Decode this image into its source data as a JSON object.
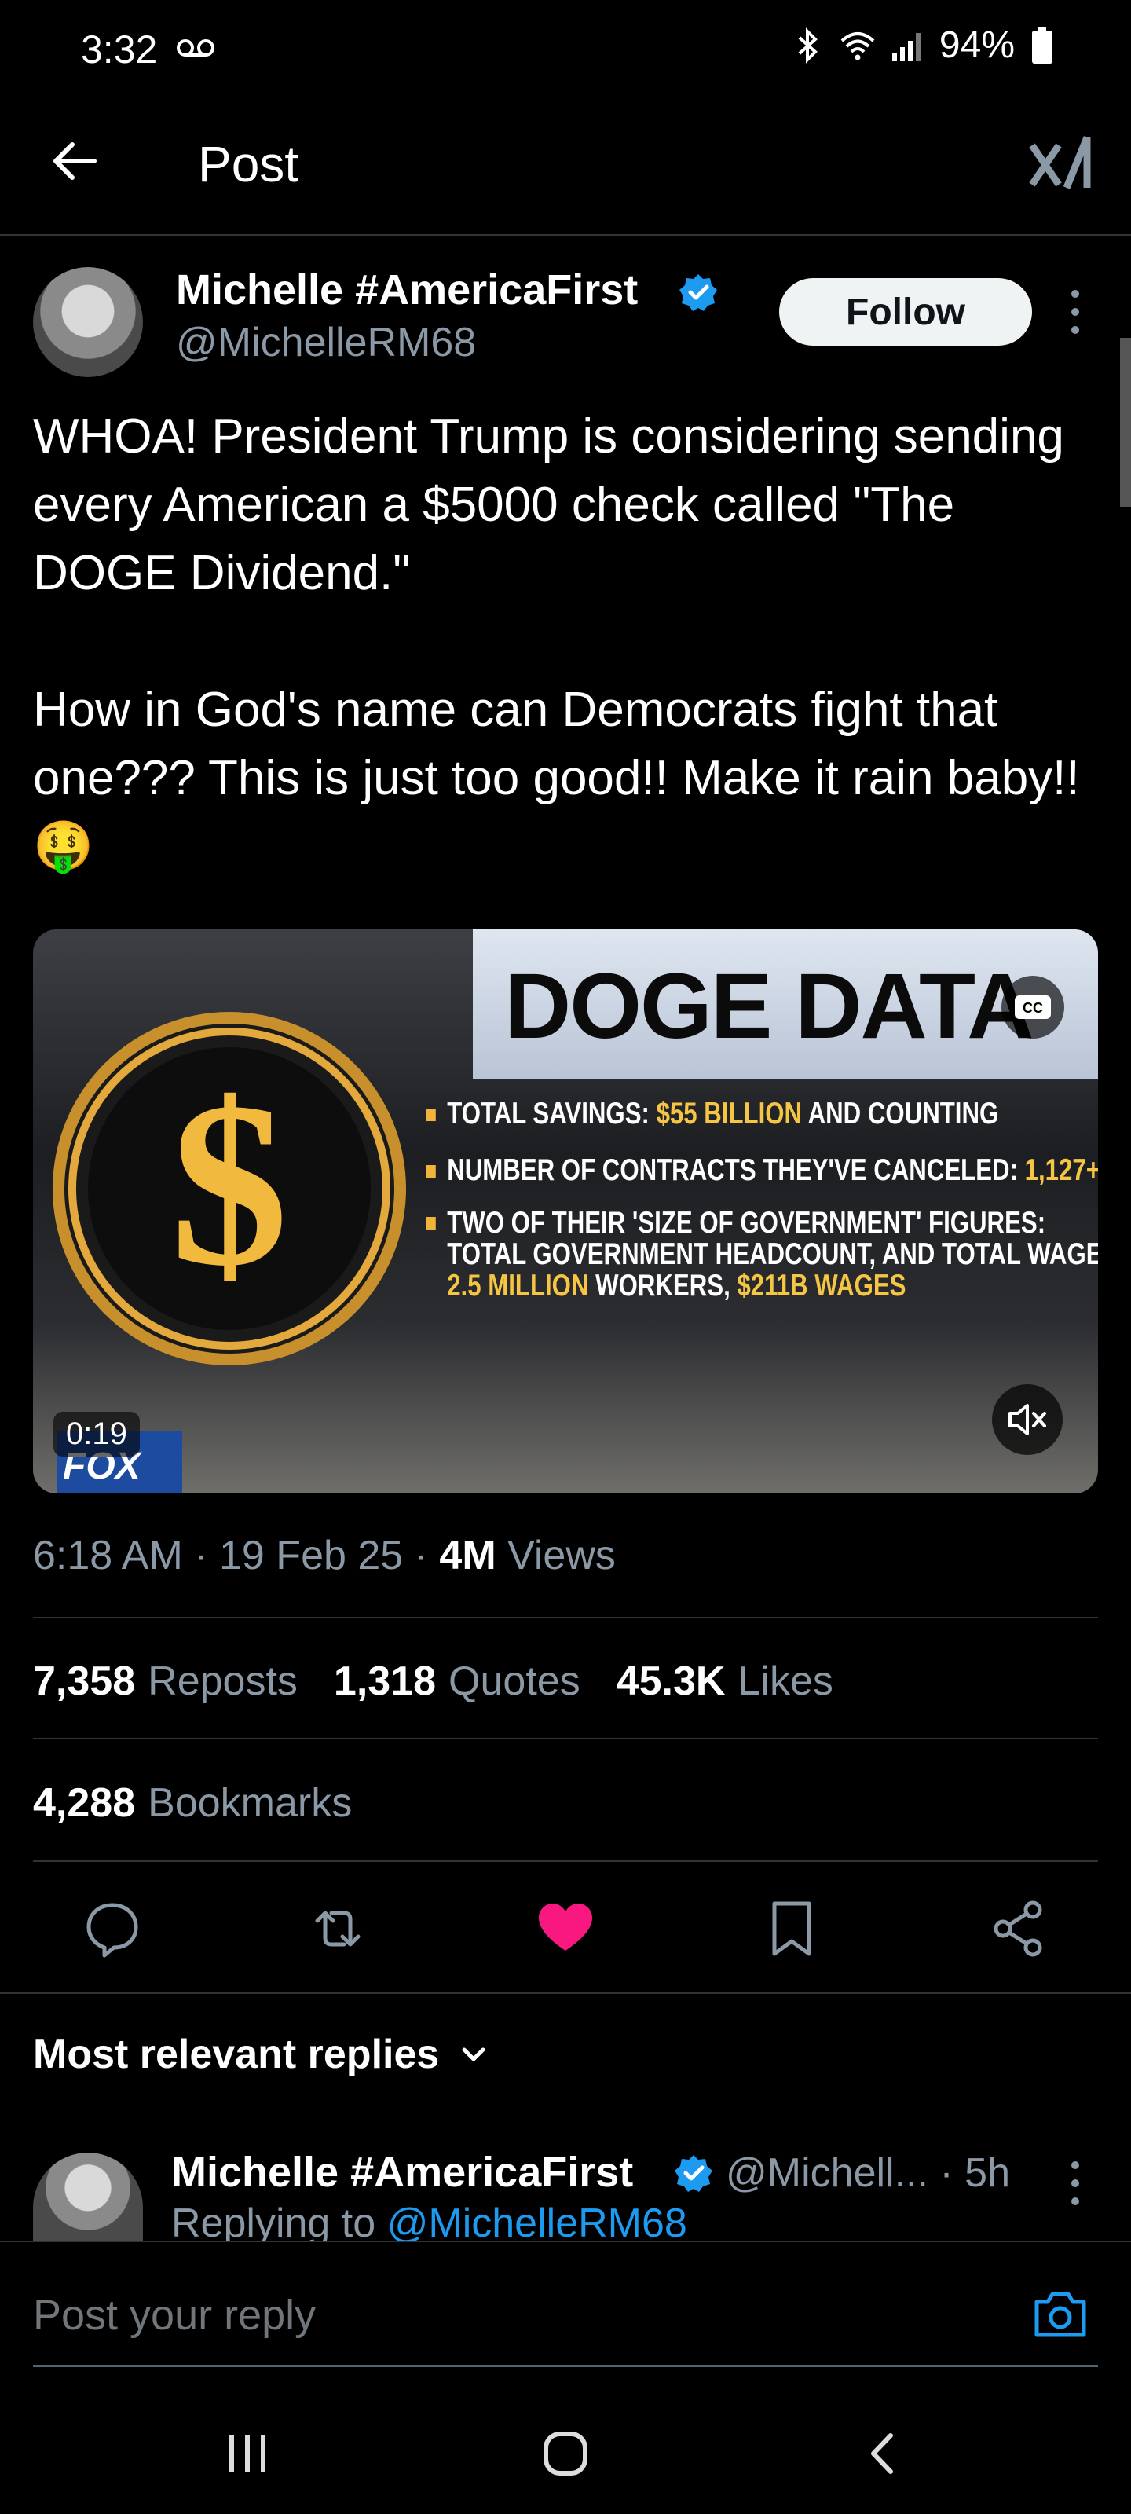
{
  "status_bar": {
    "time": "3:32",
    "battery": "94%",
    "icons": [
      "voicemail-icon",
      "bluetooth-icon",
      "wifi-icon",
      "signal-icon",
      "battery-icon"
    ]
  },
  "header": {
    "title": "Post",
    "back_icon": "arrow-left-icon",
    "grok_icon": "xai-grok-icon"
  },
  "post": {
    "author_name": "Michelle #AmericaFirst",
    "author_handle": "@MichelleRM68",
    "follow_label": "Follow",
    "text": "WHOA! President Trump is considering sending every American a $5000 check called \"The DOGE Dividend.\"\n\nHow in God's name can Democrats fight that one??? This is just too good!! Make it rain baby!!🤑",
    "media": {
      "title": "DOGE DATA",
      "bullet_1_a": "TOTAL SAVINGS: ",
      "bullet_1_b": "$55 BILLION",
      "bullet_1_c": " AND COUNTING",
      "bullet_2_a": "NUMBER OF CONTRACTS THEY'VE CANCELED: ",
      "bullet_2_b": "1,127+",
      "bullet_3_line1": "TWO OF THEIR 'SIZE OF GOVERNMENT' FIGURES:",
      "bullet_3_line2": "TOTAL GOVERNMENT HEADCOUNT, AND TOTAL WAGES:",
      "bullet_3_b": "2.5 MILLION",
      "bullet_3_c": " WORKERS, ",
      "bullet_3_d": "$211B WAGES",
      "duration": "0:19",
      "network": "FOX",
      "cc_label": "CC"
    },
    "time": "6:18 AM",
    "date": "19 Feb 25",
    "views_count": "4M",
    "views_label": "Views",
    "reposts_count": "7,358",
    "reposts_label": "Reposts",
    "quotes_count": "1,318",
    "quotes_label": "Quotes",
    "likes_count": "45.3K",
    "likes_label": "Likes",
    "bookmarks_count": "4,288",
    "bookmarks_label": "Bookmarks",
    "colors": {
      "like": "#f91880",
      "link": "#1d9bf0",
      "verified": "#1d9bf0"
    }
  },
  "replies": {
    "heading": "Most relevant replies",
    "items": [
      {
        "author_name": "Michelle #AmericaFirst",
        "handle_time": "@Michell... · 5h",
        "replying_prefix": "Replying to ",
        "replying_handle": "@MichelleRM68"
      }
    ]
  },
  "composer": {
    "placeholder": "Post your reply"
  }
}
